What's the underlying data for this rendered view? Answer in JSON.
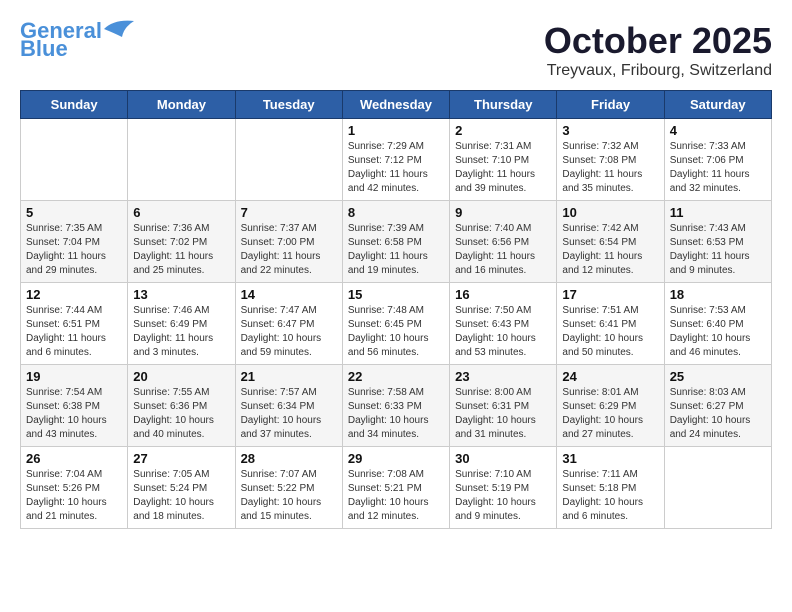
{
  "header": {
    "logo_line1": "General",
    "logo_line2": "Blue",
    "month": "October 2025",
    "location": "Treyvaux, Fribourg, Switzerland"
  },
  "weekdays": [
    "Sunday",
    "Monday",
    "Tuesday",
    "Wednesday",
    "Thursday",
    "Friday",
    "Saturday"
  ],
  "weeks": [
    [
      {
        "day": "",
        "info": ""
      },
      {
        "day": "",
        "info": ""
      },
      {
        "day": "",
        "info": ""
      },
      {
        "day": "1",
        "info": "Sunrise: 7:29 AM\nSunset: 7:12 PM\nDaylight: 11 hours\nand 42 minutes."
      },
      {
        "day": "2",
        "info": "Sunrise: 7:31 AM\nSunset: 7:10 PM\nDaylight: 11 hours\nand 39 minutes."
      },
      {
        "day": "3",
        "info": "Sunrise: 7:32 AM\nSunset: 7:08 PM\nDaylight: 11 hours\nand 35 minutes."
      },
      {
        "day": "4",
        "info": "Sunrise: 7:33 AM\nSunset: 7:06 PM\nDaylight: 11 hours\nand 32 minutes."
      }
    ],
    [
      {
        "day": "5",
        "info": "Sunrise: 7:35 AM\nSunset: 7:04 PM\nDaylight: 11 hours\nand 29 minutes."
      },
      {
        "day": "6",
        "info": "Sunrise: 7:36 AM\nSunset: 7:02 PM\nDaylight: 11 hours\nand 25 minutes."
      },
      {
        "day": "7",
        "info": "Sunrise: 7:37 AM\nSunset: 7:00 PM\nDaylight: 11 hours\nand 22 minutes."
      },
      {
        "day": "8",
        "info": "Sunrise: 7:39 AM\nSunset: 6:58 PM\nDaylight: 11 hours\nand 19 minutes."
      },
      {
        "day": "9",
        "info": "Sunrise: 7:40 AM\nSunset: 6:56 PM\nDaylight: 11 hours\nand 16 minutes."
      },
      {
        "day": "10",
        "info": "Sunrise: 7:42 AM\nSunset: 6:54 PM\nDaylight: 11 hours\nand 12 minutes."
      },
      {
        "day": "11",
        "info": "Sunrise: 7:43 AM\nSunset: 6:53 PM\nDaylight: 11 hours\nand 9 minutes."
      }
    ],
    [
      {
        "day": "12",
        "info": "Sunrise: 7:44 AM\nSunset: 6:51 PM\nDaylight: 11 hours\nand 6 minutes."
      },
      {
        "day": "13",
        "info": "Sunrise: 7:46 AM\nSunset: 6:49 PM\nDaylight: 11 hours\nand 3 minutes."
      },
      {
        "day": "14",
        "info": "Sunrise: 7:47 AM\nSunset: 6:47 PM\nDaylight: 10 hours\nand 59 minutes."
      },
      {
        "day": "15",
        "info": "Sunrise: 7:48 AM\nSunset: 6:45 PM\nDaylight: 10 hours\nand 56 minutes."
      },
      {
        "day": "16",
        "info": "Sunrise: 7:50 AM\nSunset: 6:43 PM\nDaylight: 10 hours\nand 53 minutes."
      },
      {
        "day": "17",
        "info": "Sunrise: 7:51 AM\nSunset: 6:41 PM\nDaylight: 10 hours\nand 50 minutes."
      },
      {
        "day": "18",
        "info": "Sunrise: 7:53 AM\nSunset: 6:40 PM\nDaylight: 10 hours\nand 46 minutes."
      }
    ],
    [
      {
        "day": "19",
        "info": "Sunrise: 7:54 AM\nSunset: 6:38 PM\nDaylight: 10 hours\nand 43 minutes."
      },
      {
        "day": "20",
        "info": "Sunrise: 7:55 AM\nSunset: 6:36 PM\nDaylight: 10 hours\nand 40 minutes."
      },
      {
        "day": "21",
        "info": "Sunrise: 7:57 AM\nSunset: 6:34 PM\nDaylight: 10 hours\nand 37 minutes."
      },
      {
        "day": "22",
        "info": "Sunrise: 7:58 AM\nSunset: 6:33 PM\nDaylight: 10 hours\nand 34 minutes."
      },
      {
        "day": "23",
        "info": "Sunrise: 8:00 AM\nSunset: 6:31 PM\nDaylight: 10 hours\nand 31 minutes."
      },
      {
        "day": "24",
        "info": "Sunrise: 8:01 AM\nSunset: 6:29 PM\nDaylight: 10 hours\nand 27 minutes."
      },
      {
        "day": "25",
        "info": "Sunrise: 8:03 AM\nSunset: 6:27 PM\nDaylight: 10 hours\nand 24 minutes."
      }
    ],
    [
      {
        "day": "26",
        "info": "Sunrise: 7:04 AM\nSunset: 5:26 PM\nDaylight: 10 hours\nand 21 minutes."
      },
      {
        "day": "27",
        "info": "Sunrise: 7:05 AM\nSunset: 5:24 PM\nDaylight: 10 hours\nand 18 minutes."
      },
      {
        "day": "28",
        "info": "Sunrise: 7:07 AM\nSunset: 5:22 PM\nDaylight: 10 hours\nand 15 minutes."
      },
      {
        "day": "29",
        "info": "Sunrise: 7:08 AM\nSunset: 5:21 PM\nDaylight: 10 hours\nand 12 minutes."
      },
      {
        "day": "30",
        "info": "Sunrise: 7:10 AM\nSunset: 5:19 PM\nDaylight: 10 hours\nand 9 minutes."
      },
      {
        "day": "31",
        "info": "Sunrise: 7:11 AM\nSunset: 5:18 PM\nDaylight: 10 hours\nand 6 minutes."
      },
      {
        "day": "",
        "info": ""
      }
    ]
  ]
}
